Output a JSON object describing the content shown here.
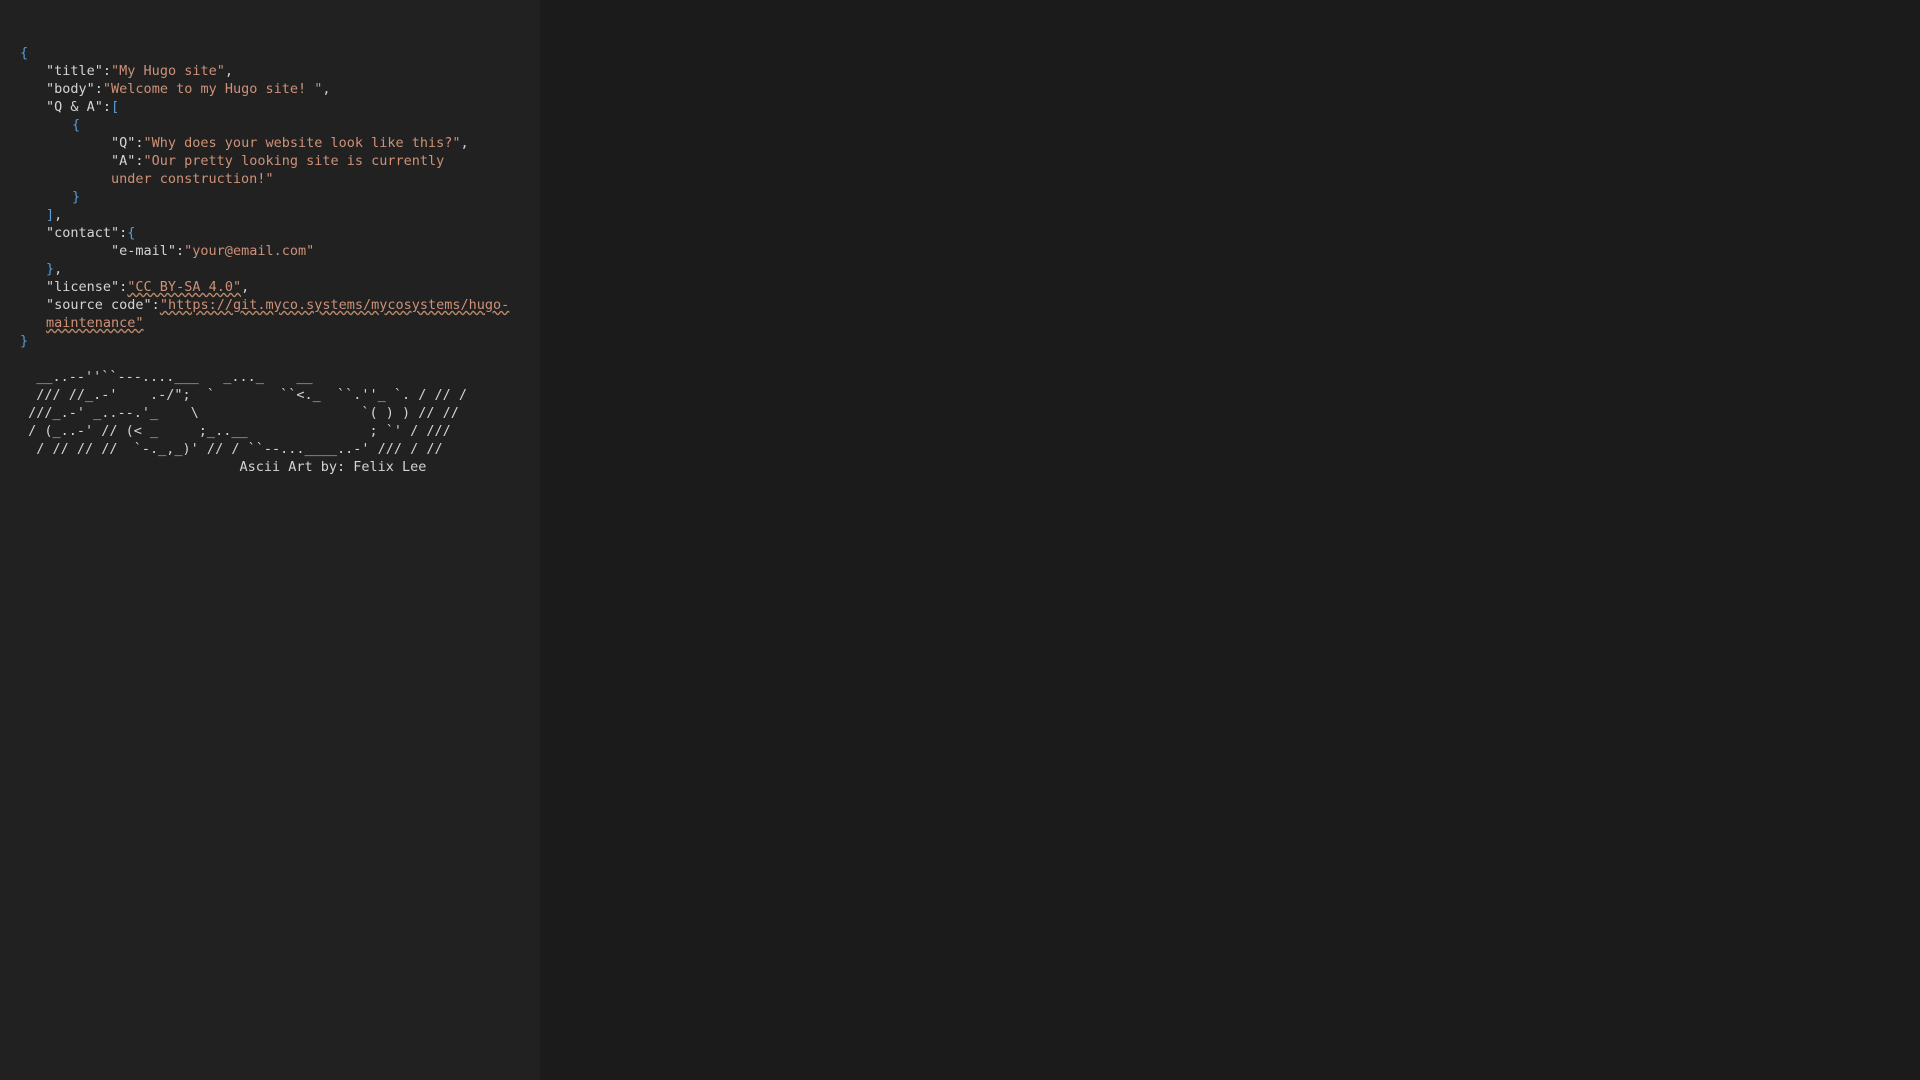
{
  "json_view": {
    "open_brace": "{",
    "close_brace": "}",
    "title": {
      "key": "\"title\"",
      "value": "\"My Hugo site\""
    },
    "body": {
      "key": "\"body\"",
      "value": "\"Welcome to my Hugo site! \""
    },
    "qa": {
      "key": "\"Q & A\"",
      "open": "[",
      "close": "]",
      "item_open": "{",
      "item_close": "}",
      "q_key": "\"Q\"",
      "q_value": "\"Why does your website look like this?\"",
      "a_key": "\"A\"",
      "a_value": "\"Our pretty looking site is currently under construction!\""
    },
    "contact": {
      "key": "\"contact\"",
      "open": "{",
      "close": "}",
      "email_key": "\"e-mail\"",
      "email_value": "\"your@email.com\""
    },
    "license": {
      "key": "\"license\"",
      "value": "\"CC BY-SA 4.0\""
    },
    "source_code": {
      "key": "\"source code\"",
      "value": "\"https://git.myco.systems/mycosystems/hugo-maintenance\""
    }
  },
  "ascii_art": {
    "lines": [
      "  __..--''``---....___   _..._    __",
      "  /// //_.-'    .-/\";  `        ``<._  ``.''_ `. / // /",
      " ///_.-' _..--.'_    \\                    `( ) ) // //",
      " / (_..-' // (< _     ;_..__               ; `' / ///",
      "  / // // //  `-._,_)' // / ``--...____..-' /// / //"
    ],
    "credit": "                           Ascii Art by: Felix Lee"
  }
}
